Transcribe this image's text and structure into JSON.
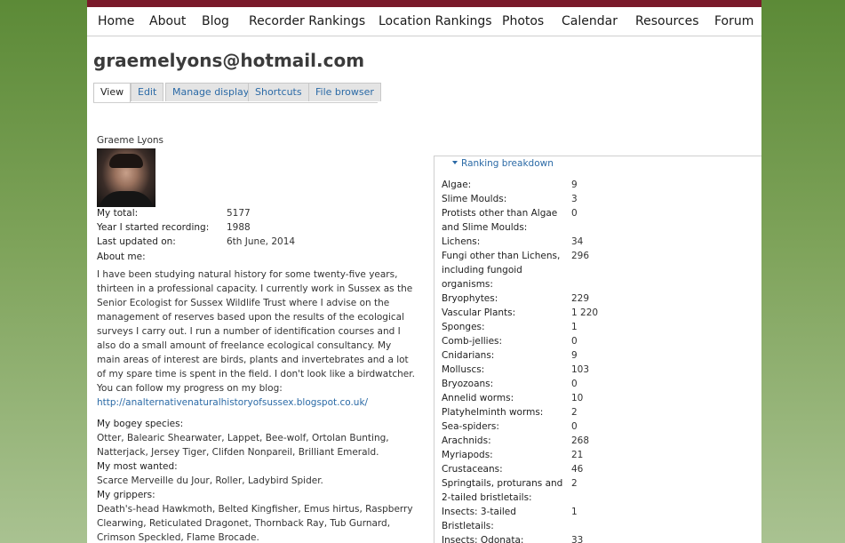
{
  "nav": {
    "items": [
      "Home",
      "About",
      "Blog",
      "Recorder Rankings",
      "Location Rankings",
      "Photos",
      "Calendar",
      "Resources",
      "Forum"
    ]
  },
  "page_title": "graemelyons@hotmail.com",
  "tabs": [
    "View",
    "Edit",
    "Manage display",
    "Shortcuts",
    "File browser"
  ],
  "active_tab": "View",
  "profile": {
    "name": "Graeme Lyons",
    "fields": [
      {
        "label": "My total:",
        "value": "5177"
      },
      {
        "label": "Year I started recording:",
        "value": "1988"
      },
      {
        "label": "Last updated on:",
        "value": "6th June, 2014"
      }
    ],
    "about_label": "About me:",
    "about_text": "I have been studying natural history for some twenty-five years, thirteen in a professional capacity. I currently work in Sussex as the Senior Ecologist for Sussex Wildlife Trust where I advise on the management of reserves based upon the results of the ecological surveys I carry out. I run a number of identification courses and I also do a small amount of freelance ecological consultancy. My main areas of interest are birds, plants and invertebrates and a lot of my spare time is spent in the field. I don't look like a birdwatcher. You can follow my progress on my blog:",
    "blog_link": "http://analternativenaturalhistoryofsussex.blogspot.co.uk/",
    "bogey_label": "My bogey species:",
    "bogey_text": "Otter, Balearic Shearwater, Lappet, Bee-wolf, Ortolan Bunting, Natterjack, Jersey Tiger, Clifden Nonpareil, Brilliant Emerald.",
    "wanted_label": "My most wanted:",
    "wanted_text": "Scarce Merveille du Jour, Roller, Ladybird Spider.",
    "grippers_label": "My grippers:",
    "grippers_text": "Death's-head Hawkmoth, Belted Kingfisher, Emus hirtus, Raspberry Clearwing, Reticulated Dragonet, Thornback Ray, Tub Gurnard, Crimson Speckled, Flame Brocade."
  },
  "ranking": {
    "legend": "Ranking breakdown",
    "rows": [
      {
        "label": "Algae:",
        "value": "9"
      },
      {
        "label": "Slime Moulds:",
        "value": "3"
      },
      {
        "label": "Protists other than Algae and Slime Moulds:",
        "value": "0"
      },
      {
        "label": "Lichens:",
        "value": "34"
      },
      {
        "label": "Fungi other than Lichens, including fungoid organisms:",
        "value": "296"
      },
      {
        "label": "Bryophytes:",
        "value": "229"
      },
      {
        "label": "Vascular Plants:",
        "value": "1 220"
      },
      {
        "label": "Sponges:",
        "value": "1"
      },
      {
        "label": "Comb-jellies:",
        "value": "0"
      },
      {
        "label": "Cnidarians:",
        "value": "9"
      },
      {
        "label": "Molluscs:",
        "value": "103"
      },
      {
        "label": "Bryozoans:",
        "value": "0"
      },
      {
        "label": "Annelid worms:",
        "value": "10"
      },
      {
        "label": "Platyhelminth worms:",
        "value": "2"
      },
      {
        "label": "Sea-spiders:",
        "value": "0"
      },
      {
        "label": "Arachnids:",
        "value": "268"
      },
      {
        "label": "Myriapods:",
        "value": "21"
      },
      {
        "label": "Crustaceans:",
        "value": "46"
      },
      {
        "label": "Springtails, proturans and 2-tailed bristletails:",
        "value": "2"
      },
      {
        "label": "Insects: 3-tailed Bristletails:",
        "value": "1"
      },
      {
        "label": "Insects: Odonata:",
        "value": "33"
      }
    ]
  },
  "colors": {
    "brand_bar": "#7a1a2a",
    "link": "#2b6aa6",
    "background_green": "#6f9a48"
  }
}
